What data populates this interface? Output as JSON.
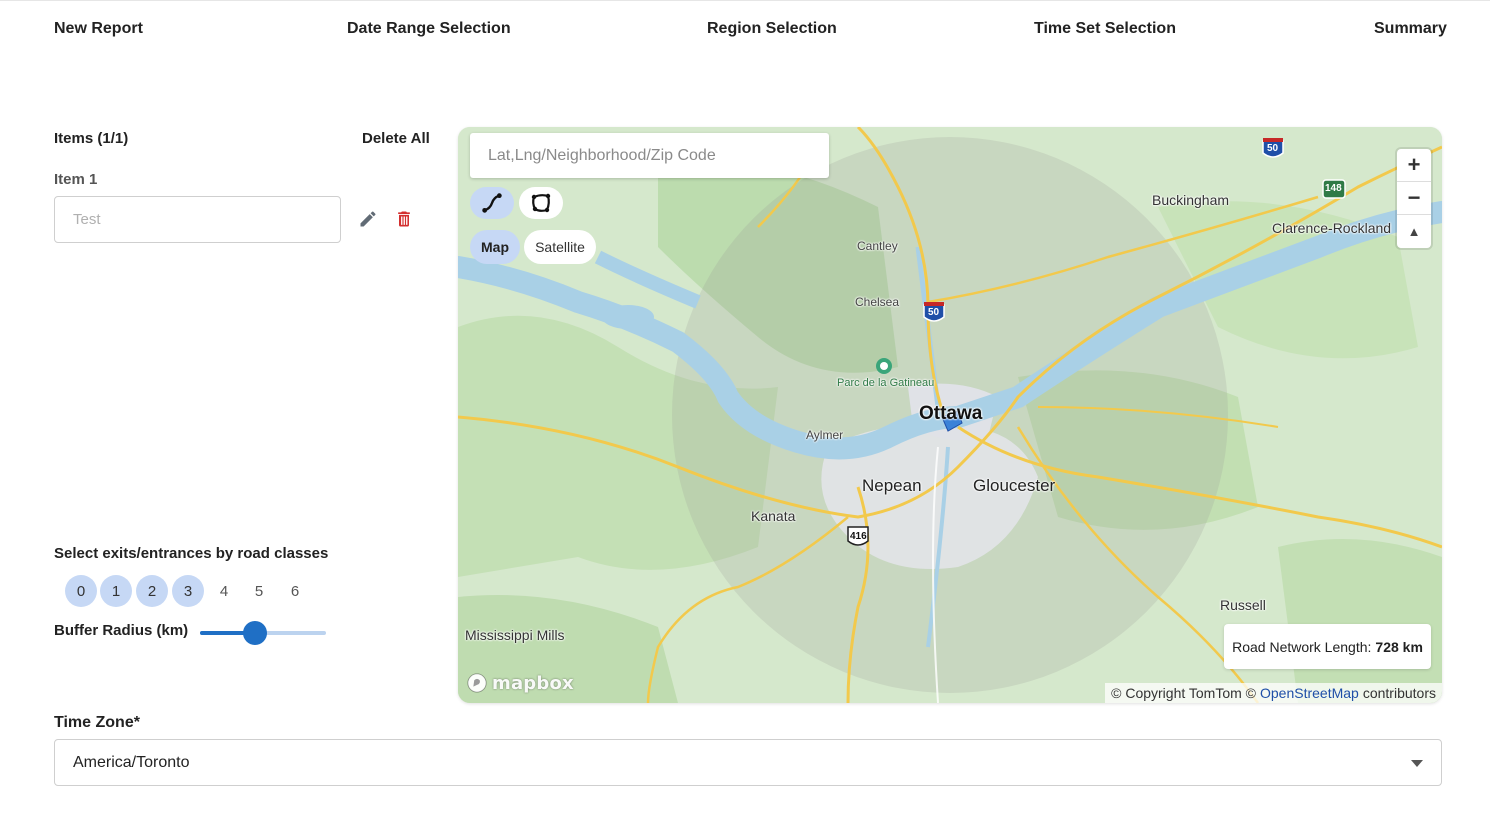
{
  "stepper": {
    "steps": [
      "New Report",
      "Date Range Selection",
      "Region Selection",
      "Time Set Selection",
      "Summary"
    ]
  },
  "items": {
    "title": "Items (1/1)",
    "delete_all": "Delete All",
    "list": [
      {
        "label": "Item 1",
        "value": "",
        "placeholder": "Test"
      }
    ]
  },
  "road_classes": {
    "title": "Select exits/entrances by road classes",
    "options": [
      "0",
      "1",
      "2",
      "3",
      "4",
      "5",
      "6"
    ],
    "selected": [
      "0",
      "1",
      "2",
      "3"
    ]
  },
  "buffer_radius": {
    "label": "Buffer Radius (km)",
    "fraction": 0.44
  },
  "map": {
    "search_placeholder": "Lat,Lng/Neighborhood/Zip Code",
    "layers": {
      "map": "Map",
      "satellite": "Satellite",
      "active": "map"
    },
    "zoom_in": "+",
    "zoom_out": "−",
    "compass": "▲",
    "road_network": {
      "label": "Road Network Length:",
      "value": "728 km"
    },
    "copyright": {
      "prefix": "© Copyright TomTom ©",
      "osm": "OpenStreetMap",
      "suffix": "contributors"
    },
    "logo_text": "mapbox",
    "places": {
      "ottawa": "Ottawa",
      "nepean": "Nepean",
      "gloucester": "Gloucester",
      "kanata": "Kanata",
      "aylmer": "Aylmer",
      "chelsea": "Chelsea",
      "cantley": "Cantley",
      "buckingham": "Buckingham",
      "clarence": "Clarence-Rockland",
      "russell": "Russell",
      "mississippi": "Mississippi Mills",
      "park": "Parc de la Gatineau"
    },
    "shields": {
      "i50": "50",
      "r148": "148",
      "h416": "416"
    },
    "colors": {
      "water": "#a9d0e6",
      "forest": "#bfdcb0",
      "urban": "#e3e5ea",
      "road": "#f2c94c",
      "buffer": "#9c9c94"
    }
  },
  "time_zone": {
    "label": "Time Zone*",
    "value": "America/Toronto"
  },
  "colors": {
    "accent": "#1f6fc5",
    "selected_bg": "#c6d8f5",
    "delete": "#d32f2f"
  }
}
